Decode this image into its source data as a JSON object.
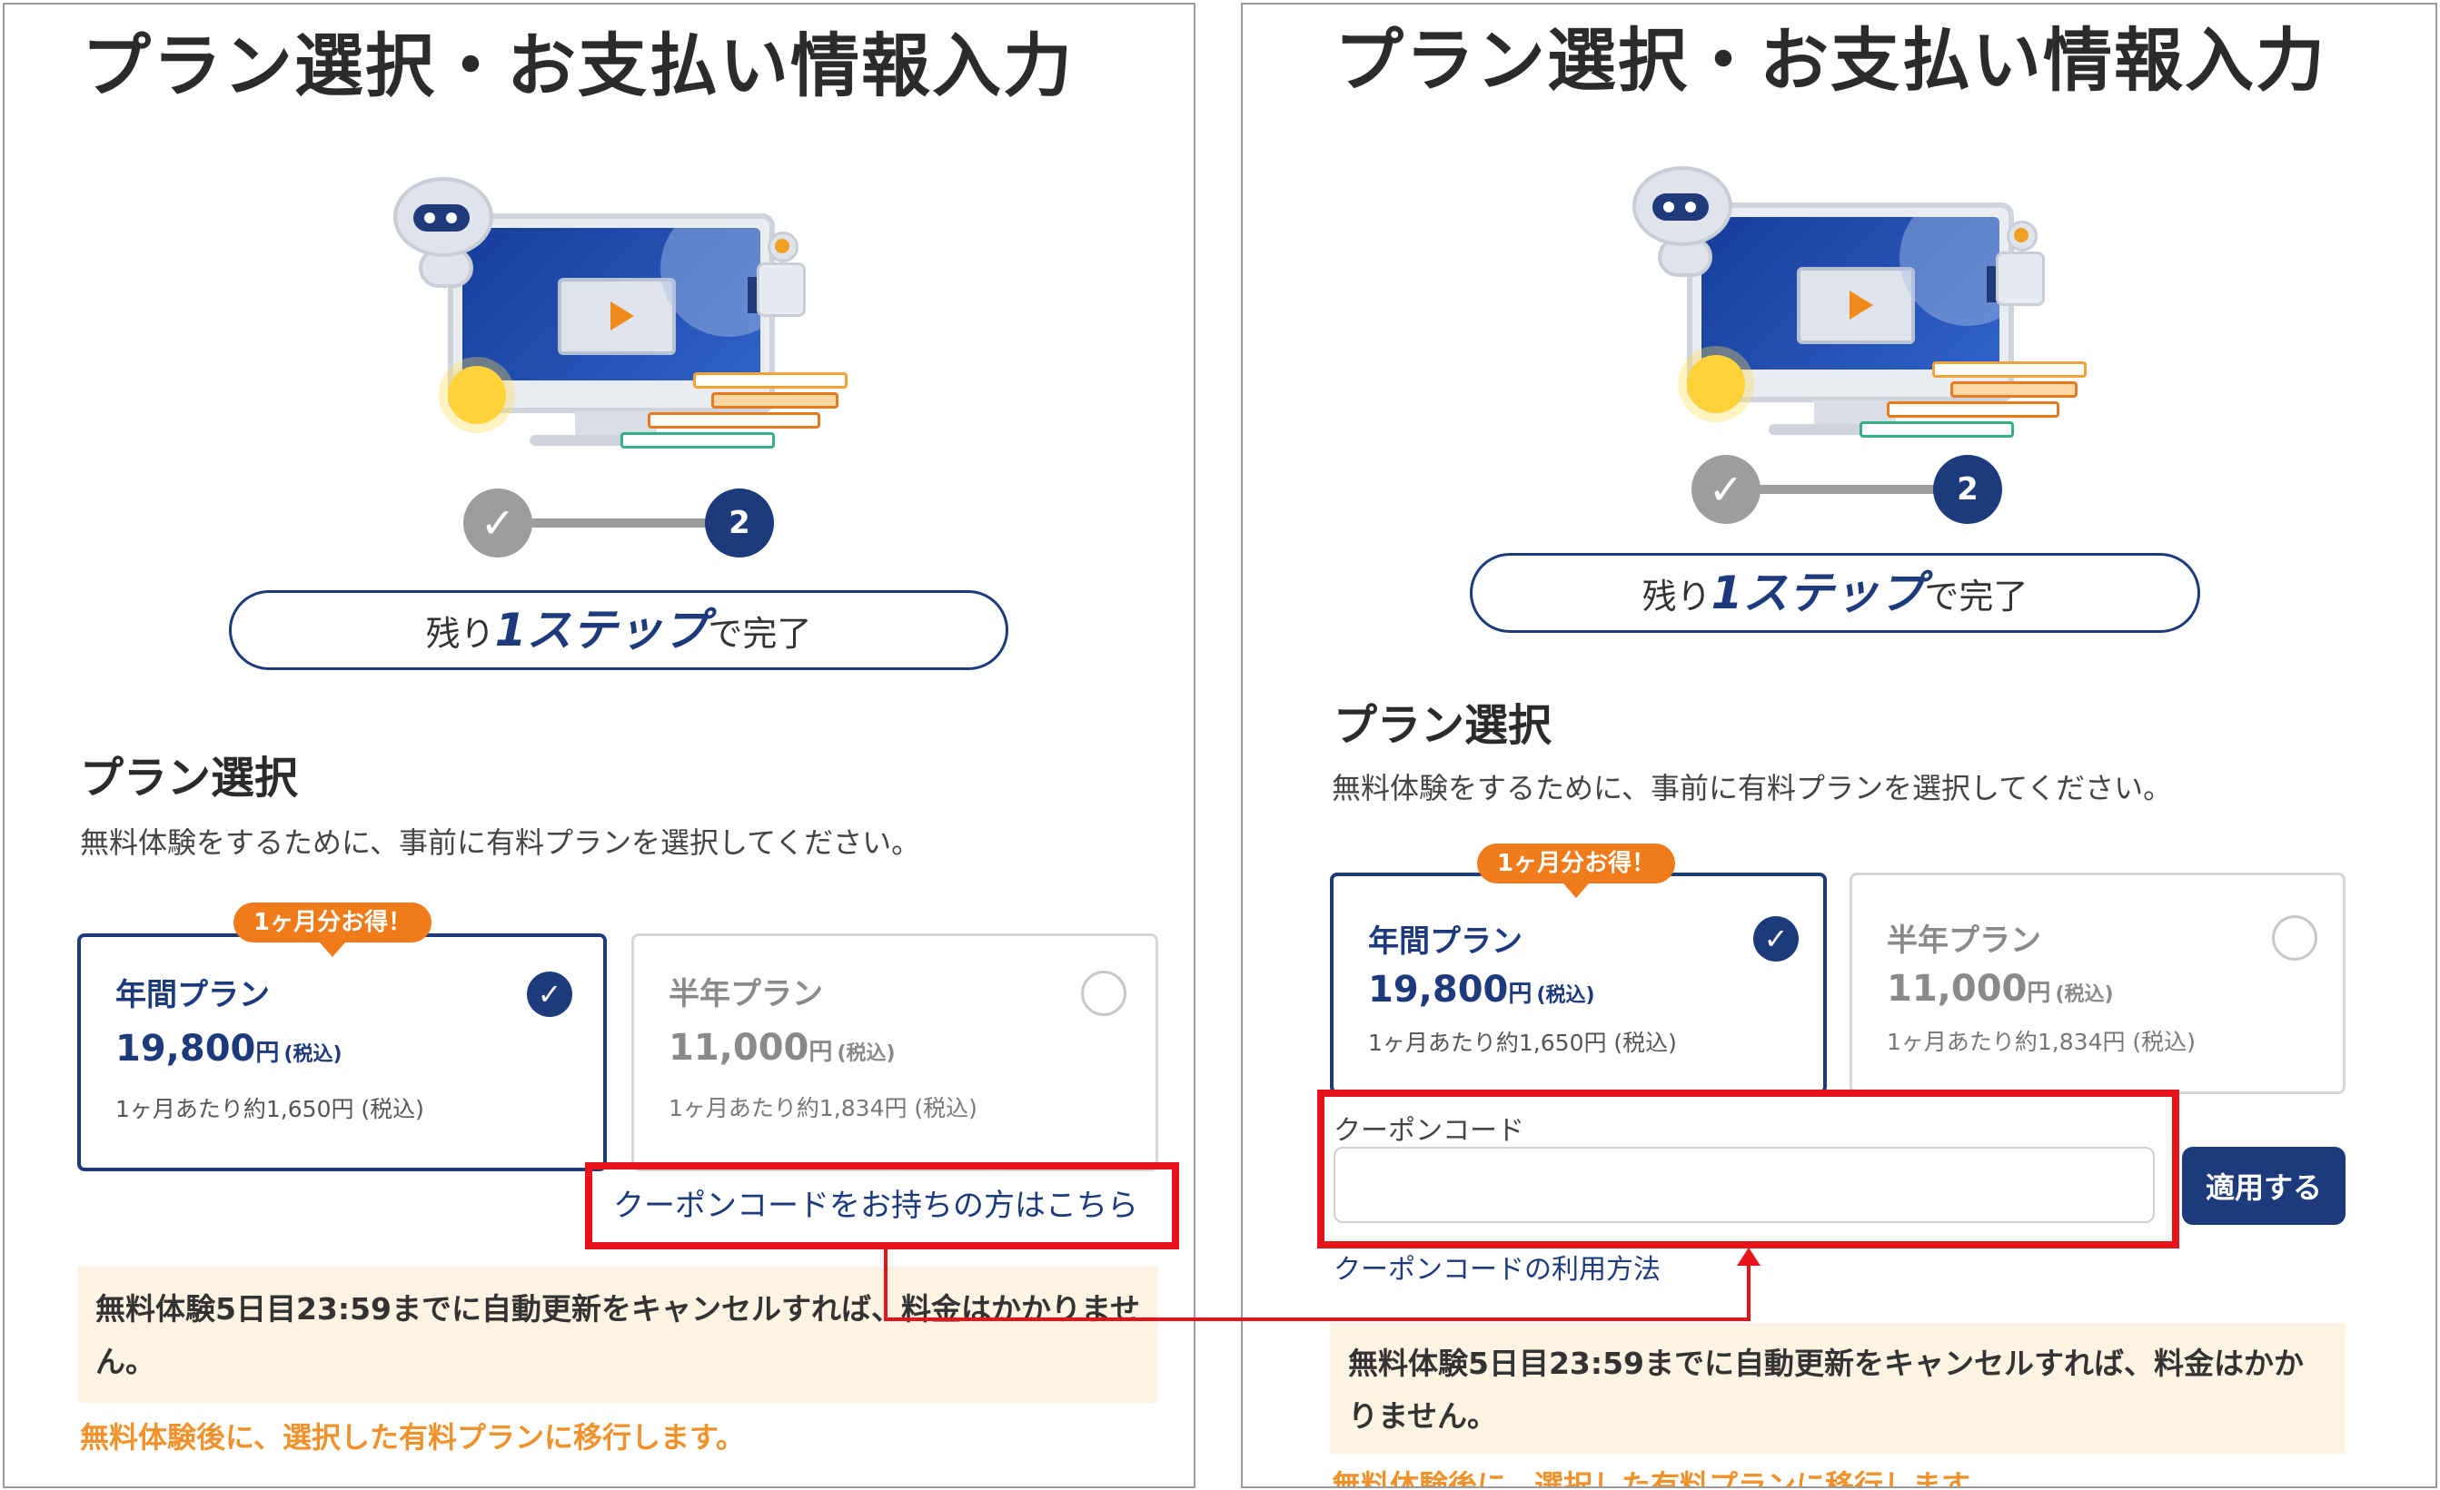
{
  "page_title": "プラン選択・お支払い情報入力",
  "stepper": {
    "done_icon": "checkmark-icon",
    "current_step": "2"
  },
  "remaining": {
    "prefix": "残り",
    "emphasis": "1ステップ",
    "suffix": "で完了"
  },
  "plan_section": {
    "title": "プラン選択",
    "description": "無料体験をするために、事前に有料プランを選択してください。"
  },
  "badge": "1ヶ月分お得！",
  "plans": [
    {
      "name": "年間プラン",
      "price": "19,800",
      "yen": "円",
      "tax": "(税込)",
      "monthly": "1ヶ月あたり約1,650円 (税込)",
      "selected": true
    },
    {
      "name": "半年プラン",
      "price": "11,000",
      "yen": "円",
      "tax": "(税込)",
      "monthly": "1ヶ月あたり約1,834円 (税込)",
      "selected": false
    }
  ],
  "coupon": {
    "toggle_link": "クーポンコードをお持ちの方はこちら",
    "label": "クーポンコード",
    "input_value": "",
    "apply_button": "適用する",
    "usage_link": "クーポンコードの利用方法"
  },
  "notice": {
    "text": "無料体験5日目23:59までに自動更新をキャンセルすれば、料金はかかりません。",
    "migrate": "無料体験後に、選択した有料プランに移行します。"
  },
  "colors": {
    "navy": "#1d3b7c",
    "orange": "#f07b1a",
    "highlight_red": "#e8121a",
    "notice_bg": "#fff3e3",
    "migrate_text": "#f0922c"
  }
}
